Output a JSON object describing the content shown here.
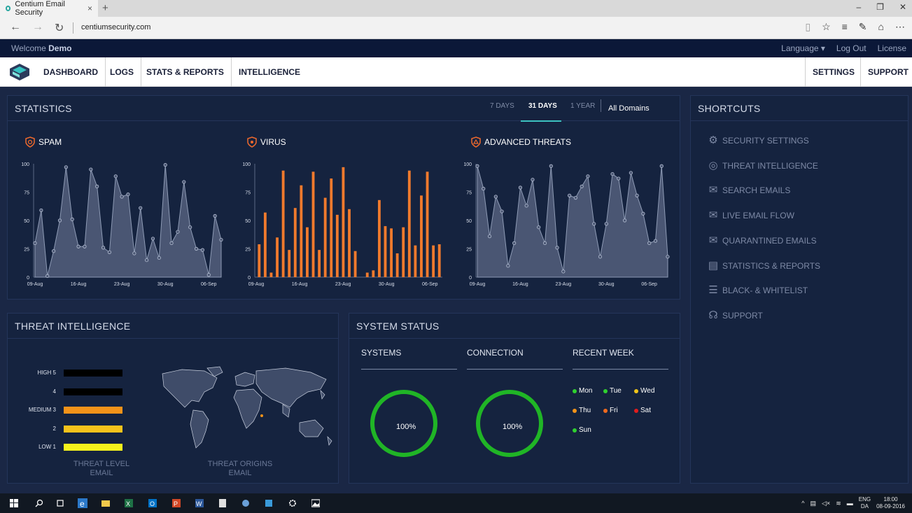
{
  "browser": {
    "tab_title": "Centium Email Security",
    "tab_close": "×",
    "new_tab": "+",
    "url": "centiumsecurity.com"
  },
  "topbar": {
    "welcome_prefix": "Welcome",
    "user": "Demo",
    "language": "Language ▾",
    "logout": "Log Out",
    "license": "License"
  },
  "nav": {
    "items": [
      "DASHBOARD",
      "LOGS",
      "STATS & REPORTS",
      "INTELLIGENCE"
    ],
    "right_items": [
      "SETTINGS",
      "SUPPORT"
    ]
  },
  "statistics": {
    "title": "STATISTICS",
    "ranges": [
      "7 DAYS",
      "31 DAYS",
      "1 YEAR"
    ],
    "active_range": "31 DAYS",
    "domains": "All Domains"
  },
  "chart_data": [
    {
      "type": "area",
      "title": "SPAM",
      "x_ticks": [
        "09-Aug",
        "16-Aug",
        "23-Aug",
        "30-Aug",
        "06-Sep"
      ],
      "y_ticks": [
        0,
        25,
        50,
        75,
        100
      ],
      "ylim": [
        0,
        100
      ],
      "values": [
        30,
        59,
        1,
        23,
        50,
        97,
        51,
        27,
        27,
        95,
        80,
        26,
        22,
        89,
        71,
        73,
        21,
        61,
        15,
        34,
        17,
        99,
        30,
        40,
        84,
        44,
        25,
        24,
        2,
        54,
        33
      ],
      "color": "#8e9bb5"
    },
    {
      "type": "bar",
      "title": "VIRUS",
      "x_ticks": [
        "09-Aug",
        "16-Aug",
        "23-Aug",
        "30-Aug",
        "06-Sep"
      ],
      "y_ticks": [
        0,
        25,
        50,
        75,
        100
      ],
      "ylim": [
        0,
        100
      ],
      "values": [
        29,
        57,
        4,
        35,
        94,
        24,
        61,
        81,
        44,
        93,
        24,
        70,
        87,
        55,
        97,
        60,
        23,
        0,
        4,
        6,
        68,
        45,
        43,
        21,
        44,
        94,
        28,
        72,
        93,
        28,
        29
      ],
      "color": "#f07a2d"
    },
    {
      "type": "area",
      "title": "ADVANCED THREATS",
      "x_ticks": [
        "09-Aug",
        "16-Aug",
        "23-Aug",
        "30-Aug",
        "06-Sep"
      ],
      "y_ticks": [
        0,
        25,
        50,
        75,
        100
      ],
      "ylim": [
        0,
        100
      ],
      "values": [
        98,
        78,
        36,
        71,
        58,
        10,
        30,
        79,
        63,
        86,
        44,
        30,
        98,
        26,
        5,
        72,
        70,
        80,
        89,
        47,
        18,
        47,
        91,
        87,
        50,
        92,
        72,
        56,
        30,
        32,
        98,
        18
      ],
      "color": "#8e9bb5"
    }
  ],
  "shortcuts": {
    "title": "SHORTCUTS",
    "items": [
      {
        "label": "SECURITY SETTINGS",
        "icon": "gears-icon"
      },
      {
        "label": "THREAT INTELLIGENCE",
        "icon": "target-icon"
      },
      {
        "label": "SEARCH EMAILS",
        "icon": "search-mail-icon"
      },
      {
        "label": "LIVE EMAIL FLOW",
        "icon": "live-mail-icon"
      },
      {
        "label": "QUARANTINED EMAILS",
        "icon": "quarantine-mail-icon"
      },
      {
        "label": "STATISTICS & REPORTS",
        "icon": "report-icon"
      },
      {
        "label": "BLACK- & WHITELIST",
        "icon": "list-icon"
      },
      {
        "label": "SUPPORT",
        "icon": "headset-icon"
      }
    ]
  },
  "threat_intelligence": {
    "title": "THREAT INTELLIGENCE",
    "levels": [
      {
        "label": "HIGH 5",
        "color": "#000000"
      },
      {
        "label": "4",
        "color": "#000000"
      },
      {
        "label": "MEDIUM 3",
        "color": "#f39319"
      },
      {
        "label": "2",
        "color": "#f5c21b"
      },
      {
        "label": "LOW 1",
        "color": "#f6f21c"
      }
    ],
    "level_footer_1": "THREAT LEVEL",
    "level_footer_2": "EMAIL",
    "origins_footer_1": "THREAT ORIGINS",
    "origins_footer_2": "EMAIL"
  },
  "system_status": {
    "title": "SYSTEM STATUS",
    "systems_label": "SYSTEMS",
    "systems_value": "100%",
    "connection_label": "CONNECTION",
    "connection_value": "100%",
    "recent_label": "RECENT WEEK",
    "days": [
      {
        "label": "Mon",
        "color": "#2fd12f"
      },
      {
        "label": "Tue",
        "color": "#2fd12f"
      },
      {
        "label": "Wed",
        "color": "#f0c419"
      },
      {
        "label": "Thu",
        "color": "#f39319"
      },
      {
        "label": "Fri",
        "color": "#f06a1e"
      },
      {
        "label": "Sat",
        "color": "#e11d1d"
      },
      {
        "label": "Sun",
        "color": "#2fd12f"
      }
    ]
  },
  "taskbar": {
    "lang": "ENG",
    "region": "DA",
    "time": "18:00",
    "date": "08-09-2016"
  }
}
